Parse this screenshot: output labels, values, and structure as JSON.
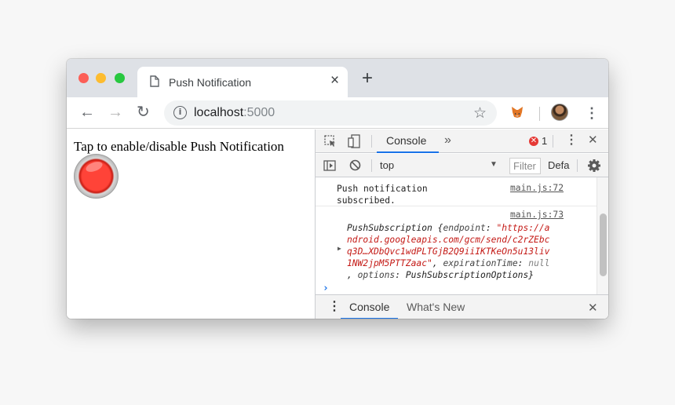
{
  "browser": {
    "tab_title": "Push Notification",
    "tab_close": "×",
    "new_tab": "+",
    "url_host": "localhost",
    "url_port": ":5000",
    "nav": {
      "back": "←",
      "forward": "→",
      "reload": "↻"
    },
    "star": "☆",
    "menu": "⋮"
  },
  "page": {
    "headline": "Tap to enable/disable Push Notification"
  },
  "devtools": {
    "tabs": {
      "console": "Console",
      "more": "»"
    },
    "error_count": "1",
    "error_badge": "✕",
    "menu": "⋮",
    "close": "✕",
    "context": "top",
    "context_arrow": "▼",
    "filter_placeholder": "Filter",
    "levels": "Defa",
    "messages": [
      {
        "text": "Push notification\nsubscribed.",
        "source": "main.js:72"
      },
      {
        "source": "main.js:73",
        "prefix": "PushSubscription {",
        "k_endpoint": "endpoint",
        "v_endpoint_1": "\"https://a",
        "v_endpoint_2": "ndroid.googleapis.com/gcm/send/c2rZEbc",
        "v_endpoint_3": "q3D…XDbQvc1wdPLTGjB2Q9iiIKTKeOn5u13liv",
        "v_endpoint_4": "1NW2jpM5PTTZaac\"",
        "k_expiration": "expirationTime",
        "v_expiration": "null",
        "k_options": "options",
        "v_options": "PushSubscriptionOptions}"
      }
    ],
    "prompt": "›",
    "drawer": {
      "menu": "⋮",
      "console_tab": "Console",
      "whats_new_tab": "What's New",
      "close": "✕"
    }
  }
}
